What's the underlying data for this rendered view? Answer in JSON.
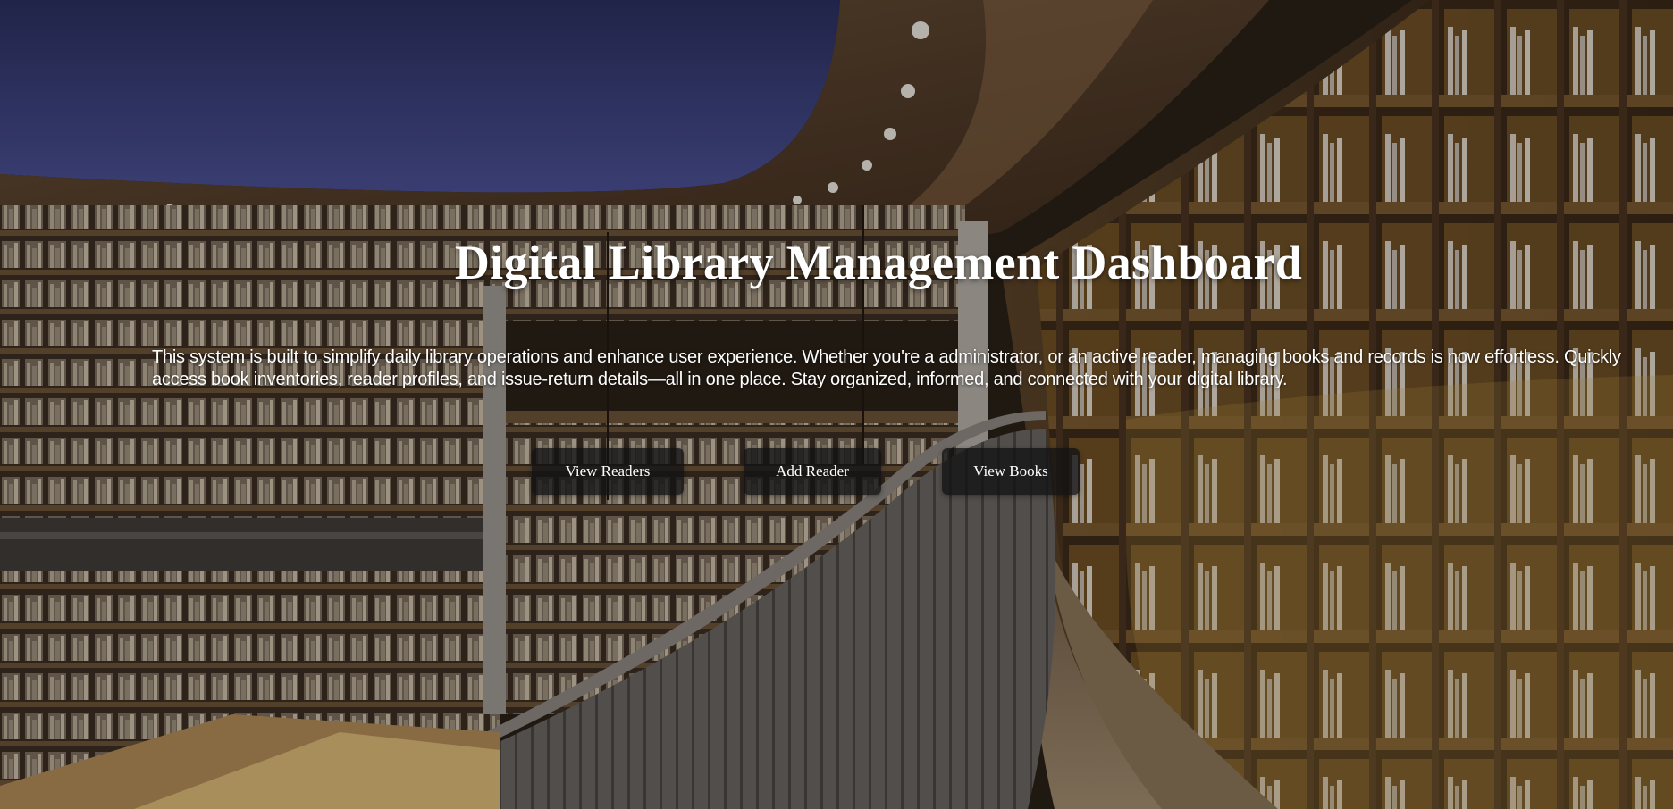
{
  "hero": {
    "title": "Digital Library Management Dashboard",
    "description": "This system is built to simplify daily library operations and enhance user experience. Whether you're a administrator, or an active reader, managing books and records is now effortless. Quickly access book inventories, reader profiles, and issue-return details—all in one place. Stay organized, informed, and connected with your digital library.",
    "background_image": "library-bookshelves-photo",
    "buttons": [
      {
        "label": "View Readers"
      },
      {
        "label": "Add Reader"
      },
      {
        "label": "View Books"
      }
    ]
  },
  "colors": {
    "text": "#ffffff",
    "button_bg": "#121214"
  }
}
